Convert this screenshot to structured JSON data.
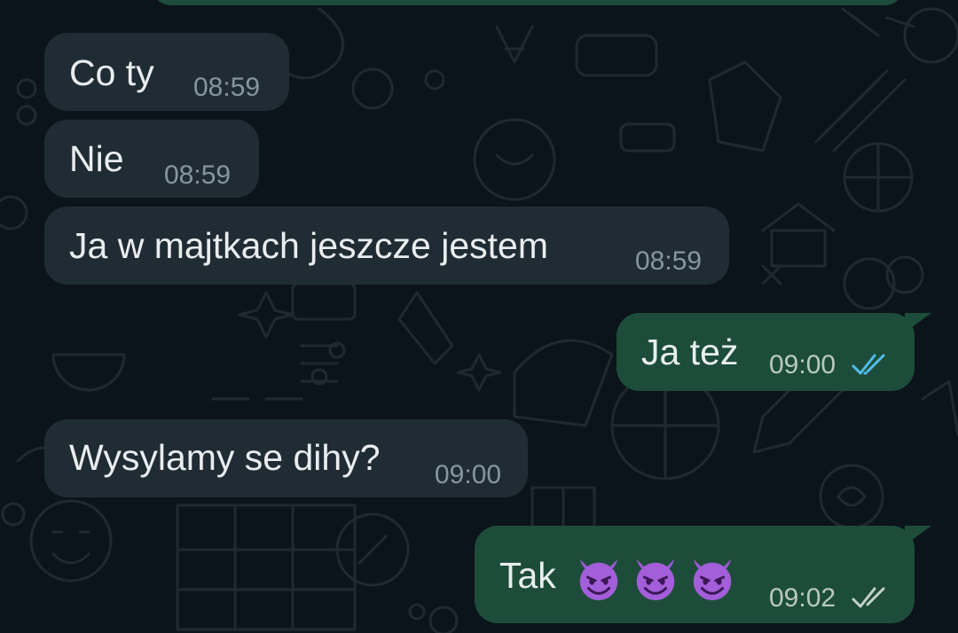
{
  "colors": {
    "background": "#0b141a",
    "incoming_bubble": "#202c33",
    "outgoing_bubble": "#1d4d3a",
    "text": "#e9edef",
    "timestamp": "#8696a0",
    "read_ticks": "#53bdeb",
    "delivered_ticks": "#c5d1cc"
  },
  "messages": [
    {
      "direction": "incoming",
      "text": "Co ty",
      "time": "08:59"
    },
    {
      "direction": "incoming",
      "text": "Nie",
      "time": "08:59"
    },
    {
      "direction": "incoming",
      "text": "Ja w majtkach jeszcze jestem",
      "time": "08:59"
    },
    {
      "direction": "outgoing",
      "text": "Ja też",
      "time": "09:00",
      "status": "read",
      "status_icon": "double-check-icon"
    },
    {
      "direction": "incoming",
      "text": "Wysylamy se dihy?",
      "time": "09:00"
    },
    {
      "direction": "outgoing",
      "text": "Tak",
      "emojis": [
        "smiling-imp-emoji",
        "smiling-imp-emoji",
        "smiling-imp-emoji"
      ],
      "time": "09:02",
      "status": "delivered",
      "status_icon": "double-check-icon"
    }
  ]
}
